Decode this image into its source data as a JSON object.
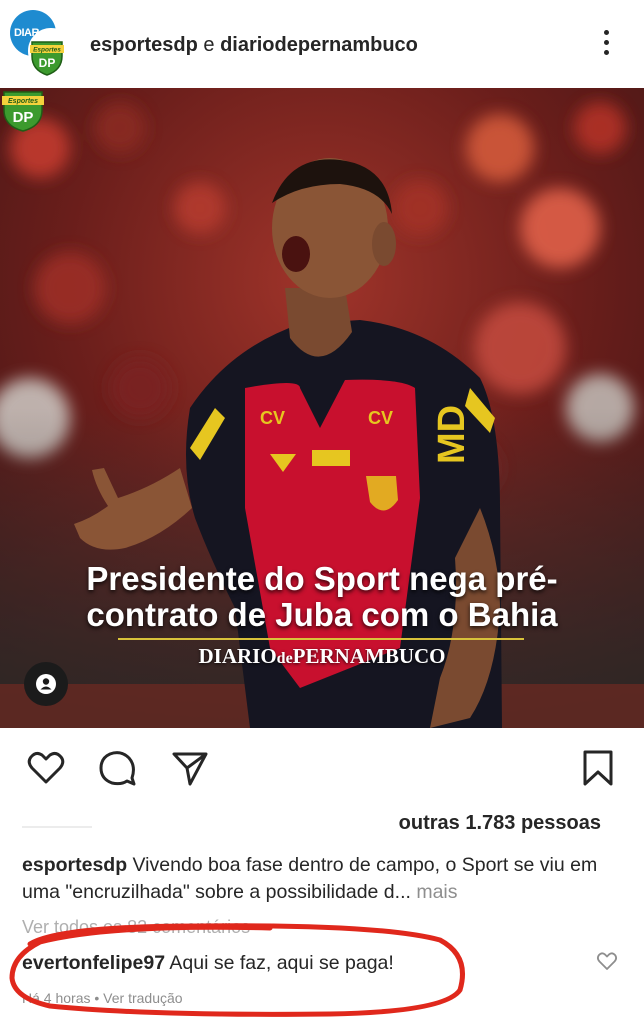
{
  "header": {
    "avatar_back_text": "DIAR",
    "account_1": "esportesdp",
    "joiner": " e ",
    "account_2": "diariodepernambuco"
  },
  "post": {
    "headline_line1": "Presidente do Sport nega pré-",
    "headline_line2": "contrato de Juba com o Bahia",
    "brand_main": "DIARIO",
    "brand_small": "de",
    "brand_end": "PERNAMBUCO",
    "badge_top": "Esportes",
    "badge_main": "DP",
    "jersey_sponsor": "MD"
  },
  "actions": {
    "like_icon": "heart-icon",
    "comment_icon": "comment-icon",
    "share_icon": "send-icon",
    "save_icon": "bookmark-icon"
  },
  "likes": {
    "text": "outras 1.783 pessoas"
  },
  "caption": {
    "username": "esportesdp",
    "text": " Vivendo boa fase dentro de campo, o Sport se viu em uma \"encruzilhada\" sobre a possibilidade d...",
    "more": " mais"
  },
  "view_all": "Ver todos os 82 comentários",
  "comment": {
    "username": "evertonfelipe97",
    "text": " Aqui se faz, aqui se paga!",
    "age": "Há 4 horas",
    "separator": " • ",
    "translate": "Ver tradução"
  },
  "colors": {
    "annotation": "#e0281c",
    "jersey_red": "#c8102e",
    "jersey_black": "#151521"
  }
}
